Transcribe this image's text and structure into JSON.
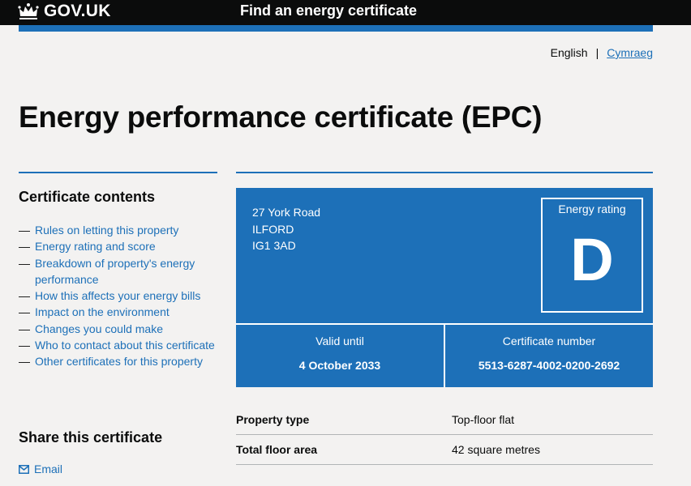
{
  "header": {
    "logo_text": "GOV.UK",
    "service_name": "Find an energy certificate"
  },
  "language": {
    "current": "English",
    "separator": "|",
    "alternate": "Cymraeg"
  },
  "page_title": "Energy performance certificate (EPC)",
  "sidebar": {
    "contents_heading": "Certificate contents",
    "items": [
      {
        "label": "Rules on letting this property"
      },
      {
        "label": "Energy rating and score"
      },
      {
        "label": "Breakdown of property's energy performance"
      },
      {
        "label": "How this affects your energy bills"
      },
      {
        "label": "Impact on the environment"
      },
      {
        "label": "Changes you could make"
      },
      {
        "label": "Who to contact about this certificate"
      },
      {
        "label": "Other certificates for this property"
      }
    ],
    "share_heading": "Share this certificate",
    "email_label": "Email"
  },
  "certificate": {
    "address_line1": "27 York Road",
    "address_line2": "ILFORD",
    "postcode": "IG1 3AD",
    "rating_label": "Energy rating",
    "rating": "D",
    "valid_until_label": "Valid until",
    "valid_until": "4 October 2033",
    "number_label": "Certificate number",
    "number": "5513-6287-4002-0200-2692"
  },
  "summary": {
    "rows": [
      {
        "key": "Property type",
        "value": "Top-floor flat"
      },
      {
        "key": "Total floor area",
        "value": "42 square metres"
      }
    ]
  },
  "colors": {
    "brand_blue": "#1d70b8",
    "header_black": "#0b0c0c",
    "background": "#f3f2f1"
  }
}
